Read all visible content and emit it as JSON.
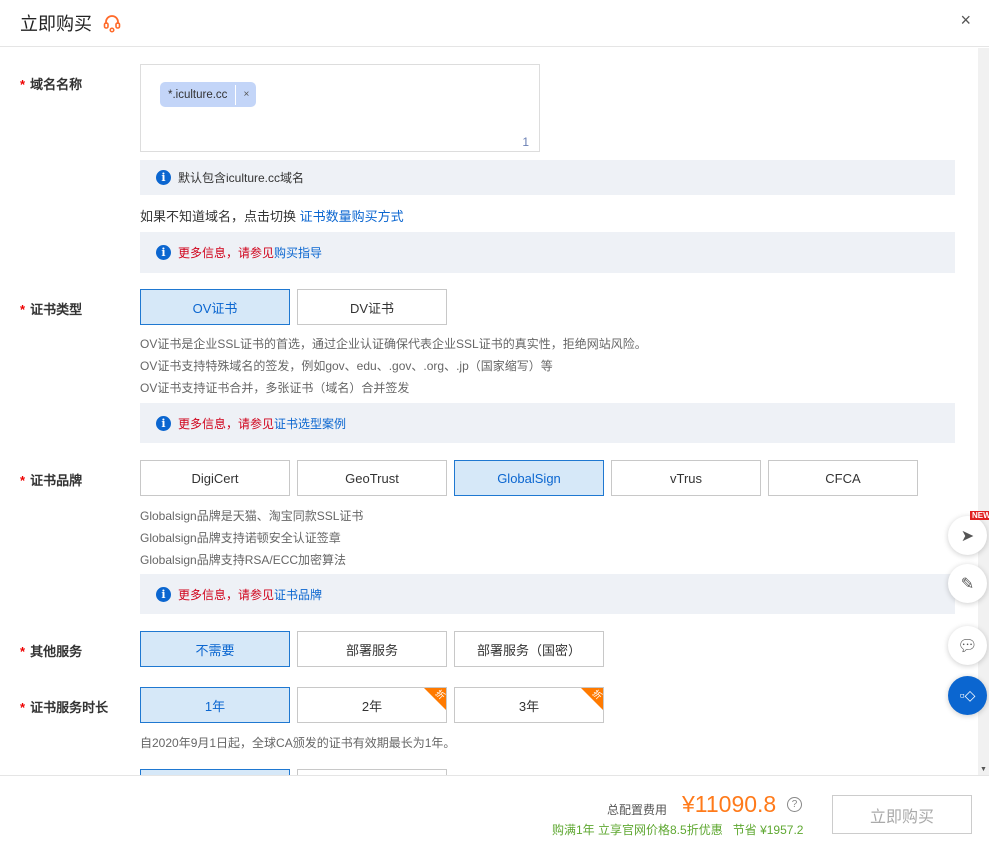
{
  "header": {
    "title": "立即购买",
    "close": "×"
  },
  "domain": {
    "label": "域名名称",
    "tag": "*.iculture.cc",
    "tag_remove": "×",
    "count": "1",
    "info": "默认包含iculture.cc域名",
    "switch_text": "如果不知道域名，点击切换",
    "switch_link": "证书数量购买方式",
    "more_red": "更多信息，请参见",
    "more_link": "购买指导"
  },
  "cert_type": {
    "label": "证书类型",
    "options": [
      "OV证书",
      "DV证书"
    ],
    "selected": "OV证书",
    "desc": [
      "OV证书是企业SSL证书的首选，通过企业认证确保代表企业SSL证书的真实性，拒绝网站风险。",
      "OV证书支持特殊域名的签发，例如gov、edu、.gov、.org、.jp（国家缩写）等",
      "OV证书支持证书合并，多张证书（域名）合并签发"
    ],
    "more_red": "更多信息，请参见",
    "more_link": "证书选型案例"
  },
  "brand": {
    "label": "证书品牌",
    "options": [
      "DigiCert",
      "GeoTrust",
      "GlobalSign",
      "vTrus",
      "CFCA"
    ],
    "selected": "GlobalSign",
    "desc": [
      "Globalsign品牌是天猫、淘宝同款SSL证书",
      "Globalsign品牌支持诺顿安全认证签章",
      "Globalsign品牌支持RSA/ECC加密算法"
    ],
    "more_red": "更多信息，请参见",
    "more_link": "证书品牌"
  },
  "service": {
    "label": "其他服务",
    "options": [
      "不需要",
      "部署服务",
      "部署服务（国密）"
    ],
    "selected": "不需要"
  },
  "duration": {
    "label": "证书服务时长",
    "options": [
      "1年",
      "2年",
      "3年"
    ],
    "selected": "1年",
    "badge": "折",
    "note": "自2020年9月1日起，全球CA颁发的证书有效期最长为1年。"
  },
  "footer": {
    "total_label": "总配置费用",
    "price": "¥11090.8",
    "help": "?",
    "promo": "购满1年 立享官网价格8.5折优惠",
    "save_label": "节省",
    "save": "¥1957.2",
    "buy": "立即购买"
  },
  "float": {
    "new_badge": "NEW"
  },
  "colors": {
    "accent": "#0b66d0",
    "price": "#ff7a1a",
    "promo": "#5fa832",
    "required": "#e00000"
  }
}
